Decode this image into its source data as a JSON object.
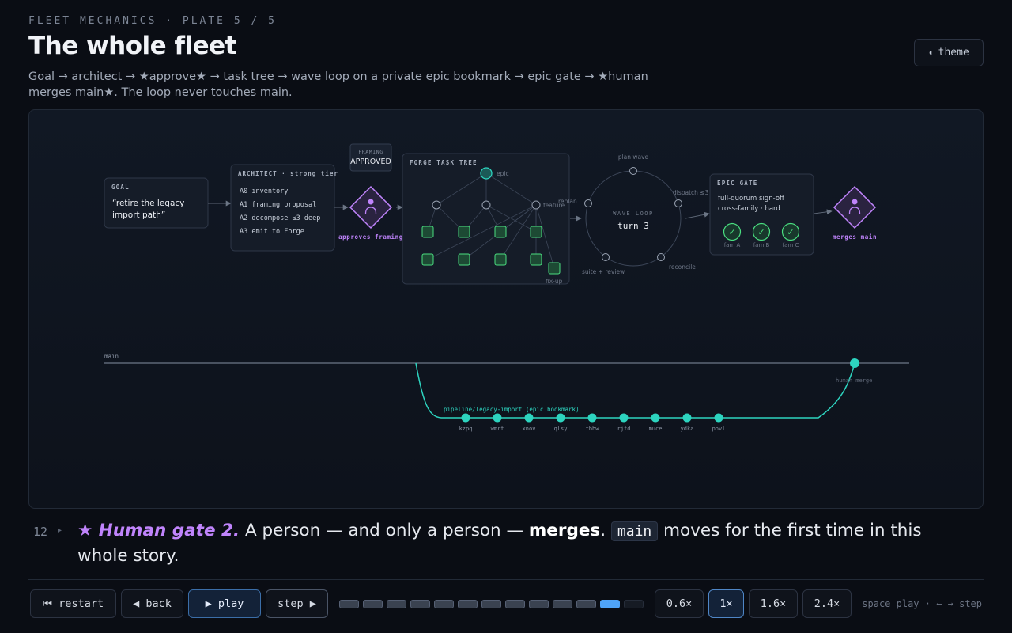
{
  "header": {
    "eyebrow": "FLEET MECHANICS · PLATE 5 / 5",
    "title": "The whole fleet",
    "subtitle": "Goal → architect → ★approve★ → task tree → wave loop on a private epic bookmark → epic gate → ★human merges main★. The loop never touches main.",
    "theme_label": "theme"
  },
  "diagram": {
    "goal": {
      "label": "GOAL",
      "line1": "“retire the legacy",
      "line2": "import path”"
    },
    "architect": {
      "label": "ARCHITECT · strong tier",
      "items": [
        "A0 inventory",
        "A1 framing proposal",
        "A2 decompose ≤3 deep",
        "A3 emit to Forge"
      ]
    },
    "framing_badge": {
      "top": "FRAMING",
      "bottom": "APPROVED"
    },
    "approve_caption": "approves framing",
    "task_tree": {
      "label": "FORGE TASK TREE",
      "epic": "epic",
      "feature": "feature",
      "fixup": "fix-up"
    },
    "wave_loop": {
      "label": "WAVE LOOP",
      "turn": "turn 3",
      "plan": "plan wave",
      "dispatch": "dispatch ≤3",
      "reconcile": "reconcile",
      "suite": "suite + review",
      "replan": "replan"
    },
    "epic_gate": {
      "label": "EPIC GATE",
      "line1": "full-quorum sign-off",
      "line2": "cross-family · hard",
      "families": [
        "fam A",
        "fam B",
        "fam C"
      ],
      "check": "✓"
    },
    "merge_caption": "merges main",
    "branch": {
      "main_label": "main",
      "bookmark_label": "pipeline/legacy-import (epic bookmark)",
      "human_merge": "human merge",
      "commits": [
        "kzpq",
        "wmrt",
        "xnov",
        "qlsy",
        "tbhw",
        "rjfd",
        "muce",
        "ydka",
        "povl"
      ]
    }
  },
  "caption": {
    "step": "12",
    "arrow": "▸",
    "highlight": "★ Human gate 2.",
    "text_a": " A person — and only a person — ",
    "bold": "merges",
    "text_b": ". ",
    "code": "main",
    "text_c": " moves for the first time in this whole story."
  },
  "controls": {
    "restart": "⏮ restart",
    "back": "◀ back",
    "play": "▶ play",
    "step": "step ▶",
    "speeds": [
      "0.6×",
      "1×",
      "1.6×",
      "2.4×"
    ],
    "active_speed": "1×",
    "hint": "space play · ← → step"
  },
  "progress": {
    "total_steps": 13,
    "current_step": 12
  },
  "colors": {
    "teal": "#2dd4bf",
    "green": "#4ade80",
    "purple": "#c084fc",
    "accent_blue": "#4fa3f7"
  }
}
